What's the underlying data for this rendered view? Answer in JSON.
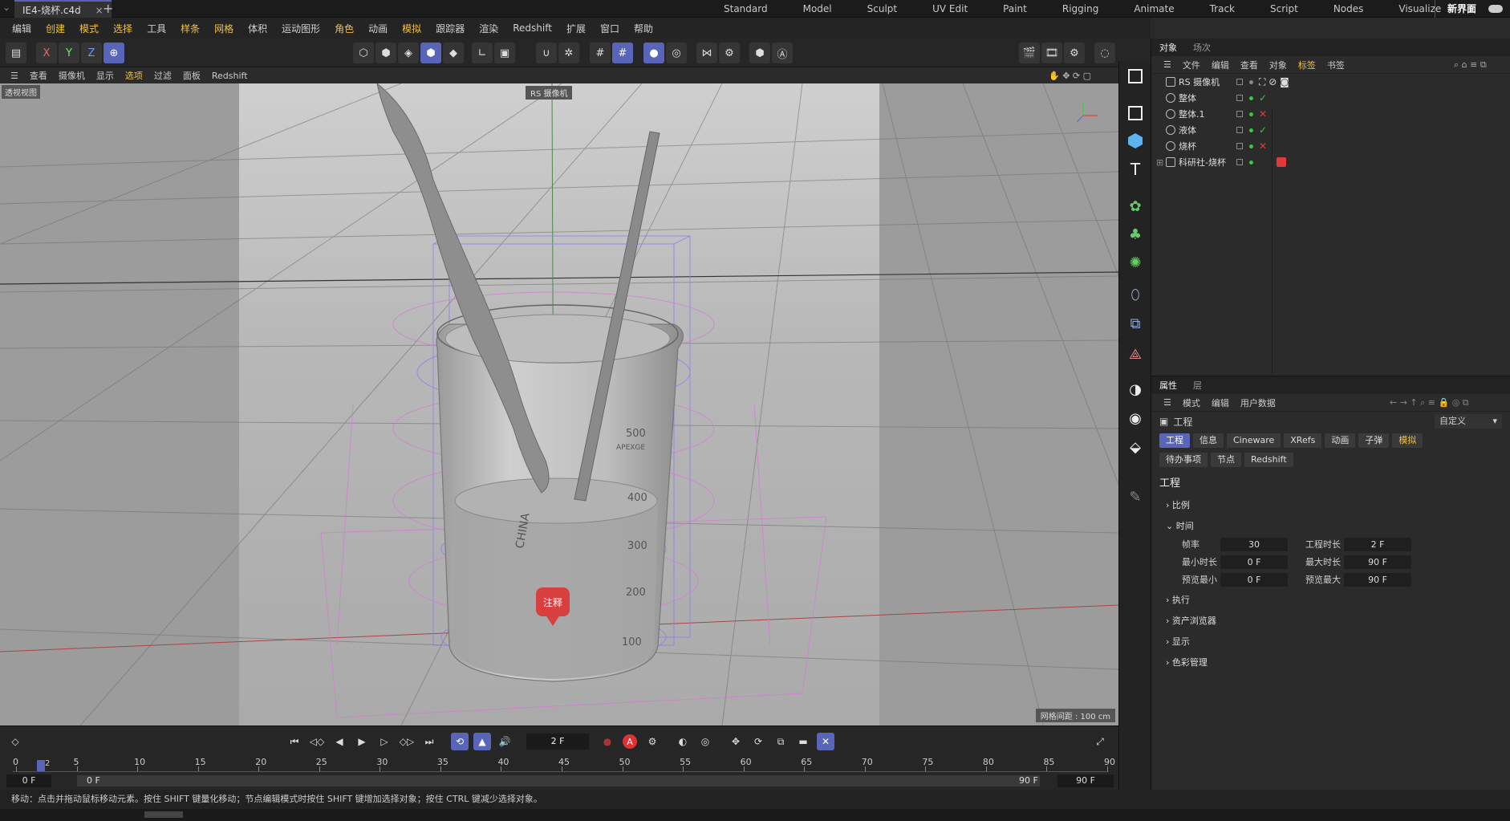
{
  "title_bar": {
    "document_tab": "IE4-烧杯.c4d",
    "close": "×",
    "add": "+",
    "layouts": [
      "Standard",
      "Model",
      "Sculpt",
      "UV Edit",
      "Paint",
      "Rigging",
      "Animate",
      "Track",
      "Script",
      "Nodes",
      "Visualize"
    ],
    "layout_add": "+",
    "new_interface": "新界面"
  },
  "menu": [
    "编辑",
    "创建",
    "模式",
    "选择",
    "工具",
    "样条",
    "网格",
    "体积",
    "运动图形",
    "角色",
    "动画",
    "模拟",
    "跟踪器",
    "渲染",
    "Redshift",
    "扩展",
    "窗口",
    "帮助"
  ],
  "toolbar": {
    "x": "X",
    "y": "Y",
    "z": "Z"
  },
  "viewport_menu": [
    "查看",
    "摄像机",
    "显示",
    "选项",
    "过滤",
    "面板",
    "Redshift"
  ],
  "viewport": {
    "view_label": "透视视图",
    "camera_label": "RS 摄像机",
    "grid_spacing": "网格间距 : 100 cm",
    "annotation": "注释",
    "beaker_marks": [
      "500",
      "400",
      "300",
      "200",
      "100"
    ],
    "beaker_brand": "APEXGE",
    "beaker_side_text": "CHINA"
  },
  "object_panel": {
    "tabs": [
      "对象",
      "场次"
    ],
    "menu": [
      "文件",
      "编辑",
      "查看",
      "对象",
      "标签",
      "书签"
    ],
    "objects": [
      {
        "name": "RS 摄像机",
        "status": "camera"
      },
      {
        "name": "整体",
        "status": "✓"
      },
      {
        "name": "整体.1",
        "status": "✕"
      },
      {
        "name": "液体",
        "status": "✓"
      },
      {
        "name": "烧杯",
        "status": "✕"
      },
      {
        "name": "科研社-烧杯",
        "status": "tag"
      }
    ]
  },
  "attributes": {
    "tabs": [
      "属性",
      "层"
    ],
    "menu": [
      "模式",
      "编辑",
      "用户数据"
    ],
    "object_label": "工程",
    "preset": "自定义",
    "chips_row1": [
      "工程",
      "信息",
      "Cineware",
      "XRefs",
      "动画",
      "子弹",
      "模拟"
    ],
    "chips_row2": [
      "待办事项",
      "节点",
      "Redshift"
    ],
    "section_title": "工程",
    "groups": [
      "比例",
      "时间",
      "执行",
      "资产浏览器",
      "显示",
      "色彩管理"
    ],
    "time_fields": {
      "fps_label": "帧率",
      "fps": "30",
      "duration_label": "工程时长",
      "duration": "2 F",
      "min_label": "最小时长",
      "min": "0 F",
      "max_label": "最大时长",
      "max": "90 F",
      "preview_min_label": "预览最小",
      "preview_min": "0 F",
      "preview_max_label": "预览最大",
      "preview_max": "90 F"
    }
  },
  "timeline": {
    "current_frame": "2 F",
    "ruler": [
      "0",
      "5",
      "10",
      "15",
      "20",
      "25",
      "30",
      "35",
      "40",
      "45",
      "50",
      "55",
      "60",
      "65",
      "70",
      "75",
      "80",
      "85",
      "90"
    ],
    "range_start": "0 F",
    "range_inner_start": "0 F",
    "range_end": "90 F",
    "range_outer_end": "90 F",
    "marker": "2"
  },
  "status": "移动：点击并拖动鼠标移动元素。按住 SHIFT 键量化移动；节点编辑模式时按住 SHIFT 键增加选择对象；按住 CTRL 键减少选择对象。",
  "colors": {
    "accent": "#5865b8",
    "highlight": "#f0c040",
    "ok": "#3ec43e",
    "bad": "#e23a3a"
  }
}
